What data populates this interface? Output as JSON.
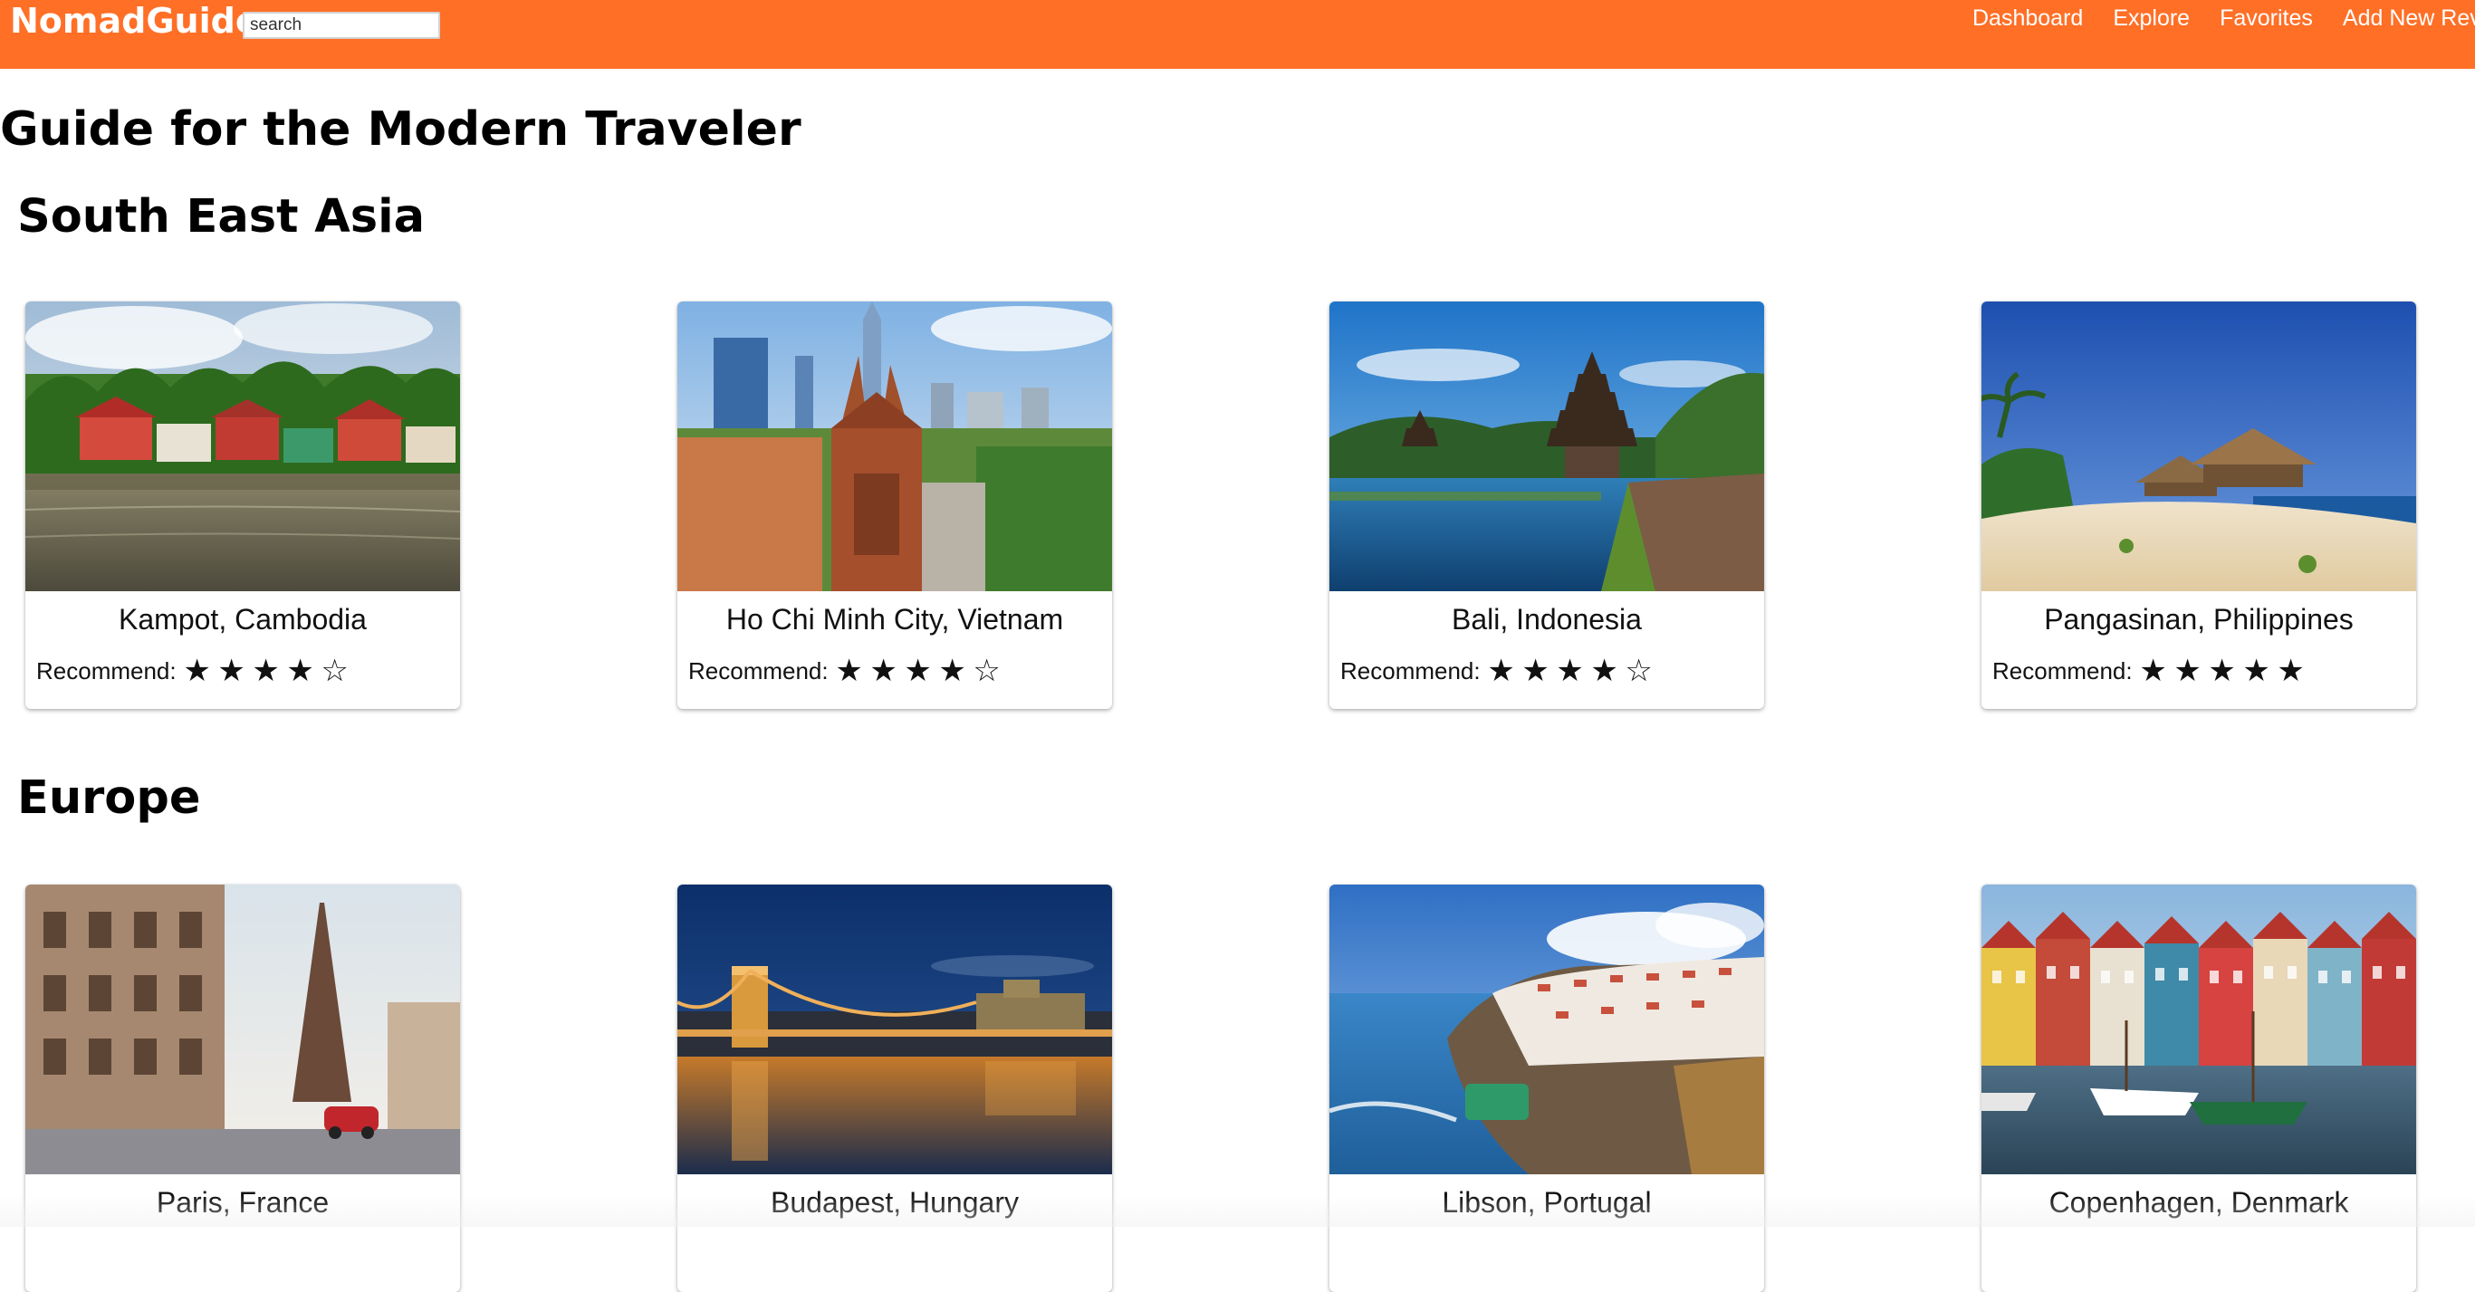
{
  "navbar": {
    "brand": "NomadGuide",
    "search_placeholder": "search",
    "links": [
      "Dashboard",
      "Explore",
      "Favorites",
      "Add New Review"
    ],
    "color": "#ff6f26"
  },
  "page_title": "Guide for the Modern Traveler",
  "sections": [
    {
      "title": "South East Asia",
      "cards": [
        {
          "name": "Kampot, Cambodia",
          "rating_label": "Recommend:",
          "rating": 4,
          "max_rating": 5
        },
        {
          "name": "Ho Chi Minh City, Vietnam",
          "rating_label": "Recommend:",
          "rating": 4,
          "max_rating": 5
        },
        {
          "name": "Bali, Indonesia",
          "rating_label": "Recommend:",
          "rating": 4,
          "max_rating": 5
        },
        {
          "name": "Pangasinan, Philippines",
          "rating_label": "Recommend:",
          "rating": 5,
          "max_rating": 5
        }
      ]
    },
    {
      "title": "Europe",
      "cards": [
        {
          "name": "Paris, France"
        },
        {
          "name": "Budapest, Hungary"
        },
        {
          "name": "Libson, Portugal"
        },
        {
          "name": "Copenhagen, Denmark"
        }
      ]
    }
  ],
  "icons": {
    "star_filled": "star-filled-icon",
    "star_empty": "star-empty-icon"
  }
}
